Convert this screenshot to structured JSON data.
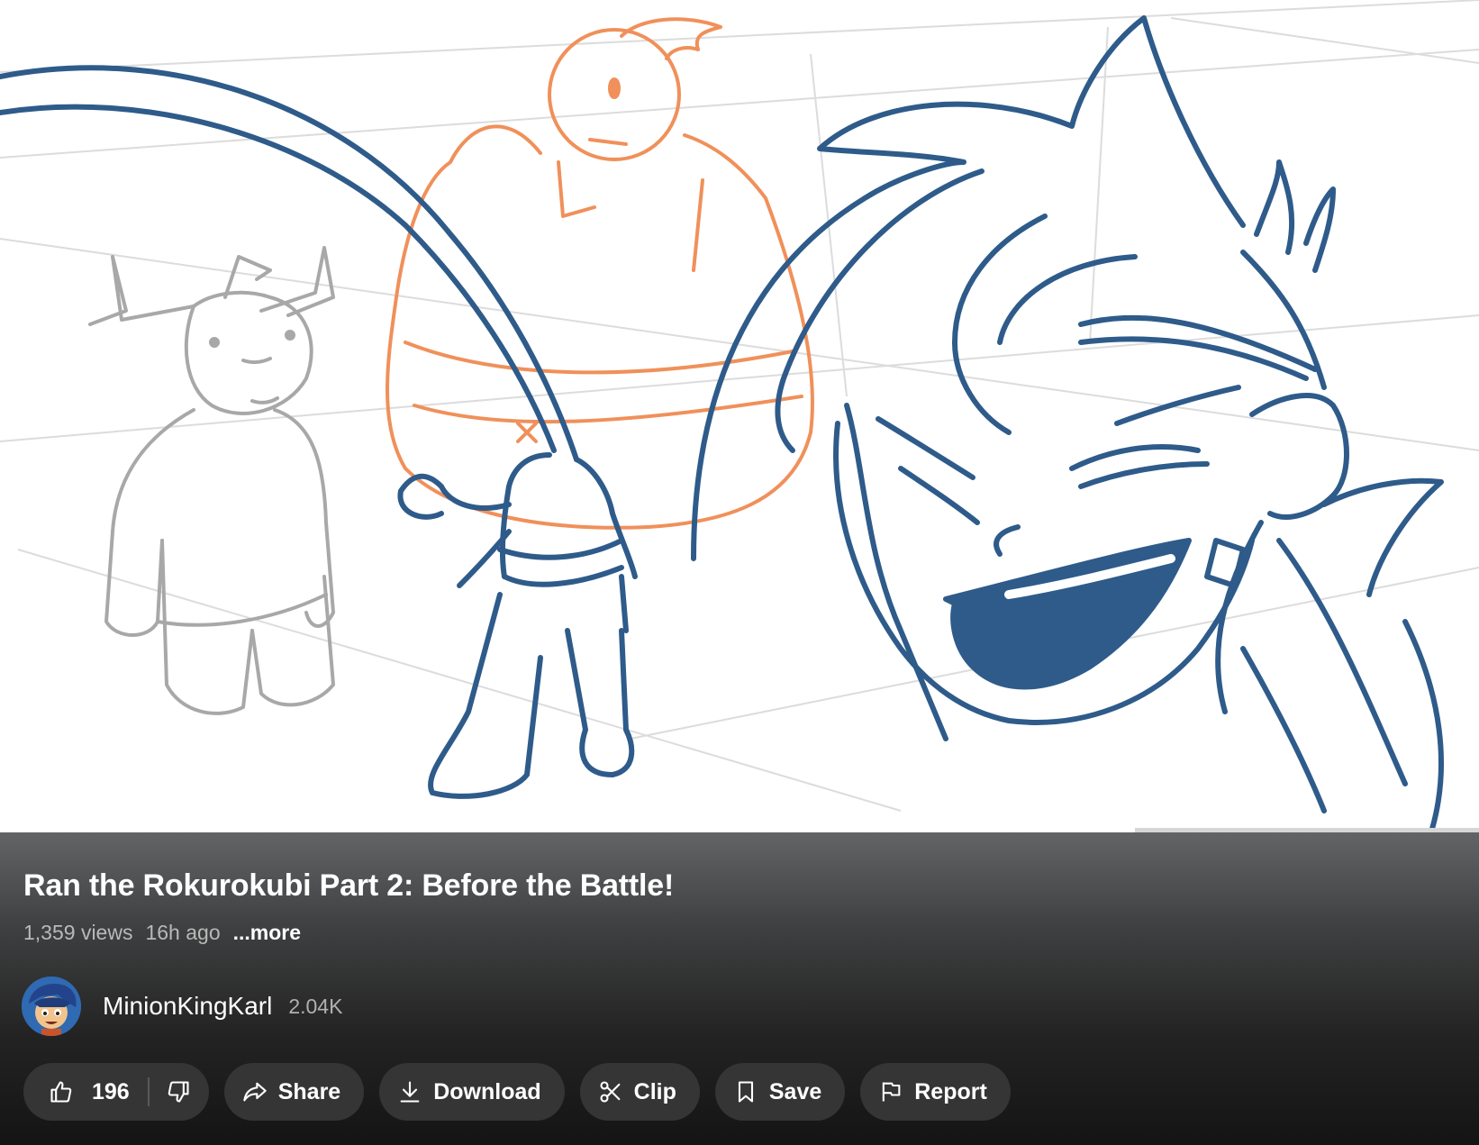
{
  "video": {
    "title": "Ran the Rokurokubi Part 2: Before the Battle!",
    "views": "1,359 views",
    "age": "16h ago",
    "more_label": "...more"
  },
  "channel": {
    "name": "MinionKingKarl",
    "subscribers": "2.04K"
  },
  "actions": {
    "like_count": "196",
    "share_label": "Share",
    "download_label": "Download",
    "clip_label": "Clip",
    "save_label": "Save",
    "report_label": "Report"
  },
  "icons": [
    "thumbs-up-icon",
    "thumbs-down-icon",
    "share-icon",
    "download-icon",
    "scissors-icon",
    "bookmark-icon",
    "flag-icon"
  ],
  "colors": {
    "sketch_blue": "#2e5b8a",
    "sketch_orange": "#f0905a",
    "sketch_gray": "#a8a8a8",
    "chip_bg": "#353535"
  }
}
